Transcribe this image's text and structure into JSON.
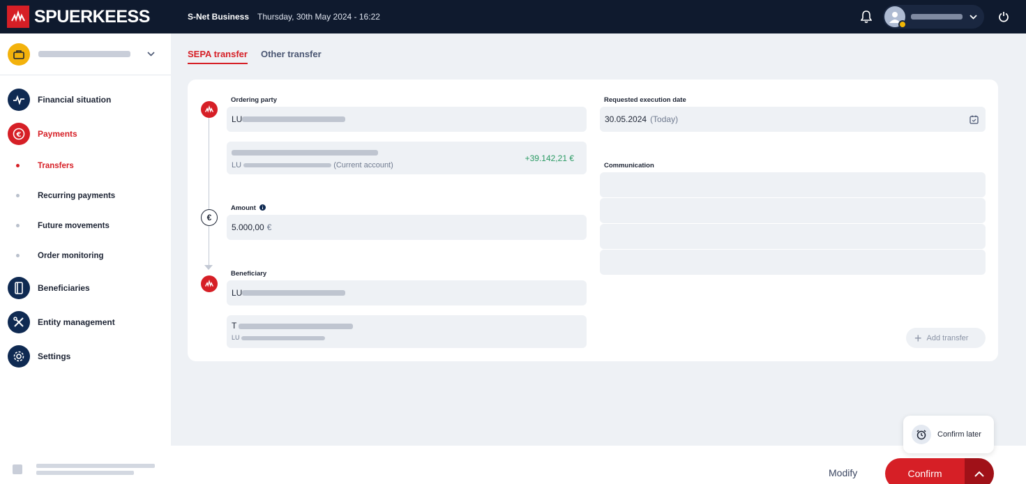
{
  "topbar": {
    "brand": "SPUERKEESS",
    "app_name": "S-Net Business",
    "datetime": "Thursday, 30th May 2024 - 16:22"
  },
  "sidebar": {
    "nav": [
      {
        "label": "Financial situation",
        "icon": "pulse-icon"
      },
      {
        "label": "Payments",
        "icon": "euro-icon",
        "active": true
      },
      {
        "label": "Beneficiaries",
        "icon": "address-book-icon"
      },
      {
        "label": "Entity management",
        "icon": "tools-icon"
      },
      {
        "label": "Settings",
        "icon": "gear-icon"
      }
    ],
    "payments_sub": [
      {
        "label": "Transfers",
        "active": true
      },
      {
        "label": "Recurring payments"
      },
      {
        "label": "Future movements"
      },
      {
        "label": "Order monitoring"
      }
    ]
  },
  "tabs": [
    {
      "label": "SEPA transfer",
      "active": true
    },
    {
      "label": "Other transfer"
    }
  ],
  "form": {
    "ordering_party_label": "Ordering party",
    "ordering_party_prefix": "LU",
    "account_suffix": "(Current account)",
    "account_prefix": "LU",
    "balance": "+39.142,21 €",
    "amount_label": "Amount",
    "amount_value": "5.000,00",
    "amount_currency": "€",
    "beneficiary_label": "Beneficiary",
    "beneficiary_prefix": "LU",
    "beneficiary_name_prefix": "T",
    "beneficiary_iban_prefix": "LU",
    "execution_date_label": "Requested execution date",
    "execution_date": "30.05.2024",
    "execution_date_hint": "(Today)",
    "communication_label": "Communication"
  },
  "actions": {
    "add_transfer": "Add transfer",
    "confirm_later": "Confirm later",
    "modify": "Modify",
    "confirm": "Confirm"
  },
  "colors": {
    "brand_red": "#d61f26",
    "navy": "#0f1a2e",
    "positive_green": "#2a9a63"
  }
}
